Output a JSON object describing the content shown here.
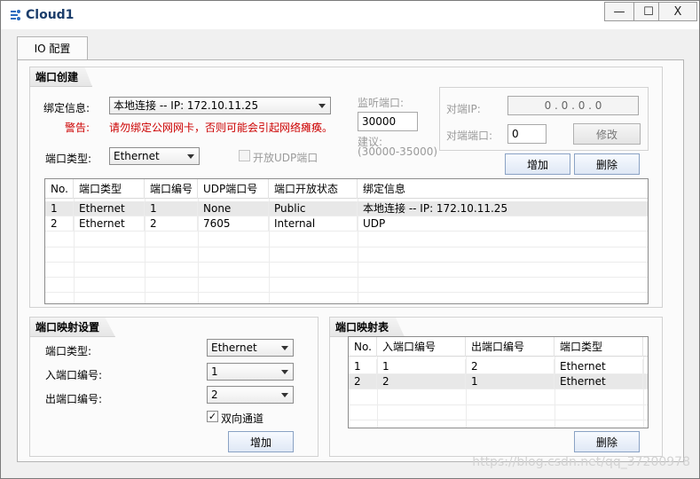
{
  "window": {
    "title": "Cloud1",
    "minimize": "—",
    "maximize": "☐",
    "close": "X"
  },
  "tabs": [
    {
      "label": "IO 配置"
    }
  ],
  "port_create": {
    "title": "端口创建",
    "bind_label": "绑定信息:",
    "bind_value": "本地连接 -- IP: 172.10.11.25",
    "warning_label": "警告:",
    "warning_text": "请勿绑定公网网卡，否则可能会引起网络瘫痪。",
    "port_type_label": "端口类型:",
    "port_type_value": "Ethernet",
    "udp_open_label": "开放UDP端口",
    "listen_port_label": "监听端口:",
    "listen_port_value": "30000",
    "suggest_label": "建议:",
    "suggest_range": "(30000-35000)",
    "peer_ip_label": "对端IP:",
    "peer_ip_value": "0 . 0 . 0 . 0",
    "peer_port_label": "对端端口:",
    "peer_port_value": "0",
    "modify_button": "修改",
    "add_button": "增加",
    "delete_button": "删除"
  },
  "port_table": {
    "columns": [
      "No.",
      "端口类型",
      "端口编号",
      "UDP端口号",
      "端口开放状态",
      "绑定信息"
    ],
    "rows": [
      [
        "1",
        "Ethernet",
        "1",
        "None",
        "Public",
        "本地连接 -- IP: 172.10.11.25"
      ],
      [
        "2",
        "Ethernet",
        "2",
        "7605",
        "Internal",
        "UDP"
      ]
    ]
  },
  "mapping_settings": {
    "title": "端口映射设置",
    "port_type_label": "端口类型:",
    "port_type_value": "Ethernet",
    "in_port_label": "入端口编号:",
    "in_port_value": "1",
    "out_port_label": "出端口编号:",
    "out_port_value": "2",
    "bidirectional_label": "双向通道",
    "bidirectional_check": "✓",
    "add_button": "增加"
  },
  "mapping_table": {
    "title": "端口映射表",
    "columns": [
      "No.",
      "入端口编号",
      "出端口编号",
      "端口类型"
    ],
    "rows": [
      [
        "1",
        "1",
        "2",
        "Ethernet"
      ],
      [
        "2",
        "2",
        "1",
        "Ethernet"
      ]
    ],
    "delete_button": "删除"
  },
  "watermark": "https://blog.csdn.net/qq_37200978"
}
